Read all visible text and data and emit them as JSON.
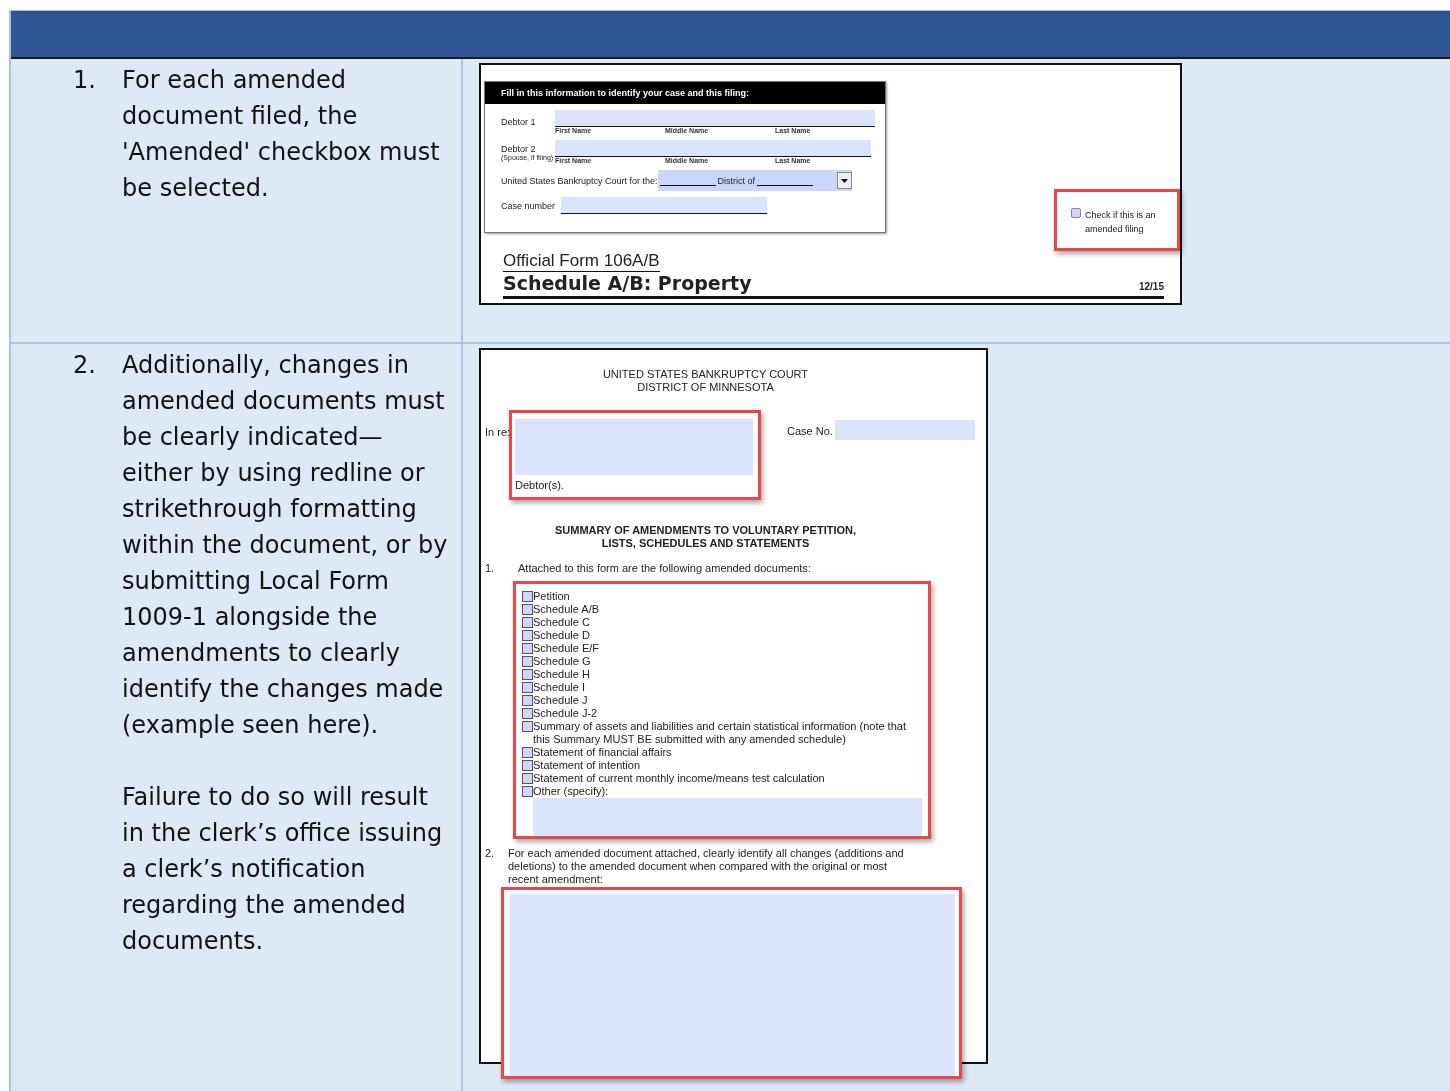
{
  "rows": [
    {
      "number": "1.",
      "paragraphs": [
        "For each amended document filed, the 'Amended' checkbox must be selected."
      ],
      "figure": {
        "kind": "form_header",
        "box_title": "Fill in this information to identify your case and this filing:",
        "debtors": [
          {
            "label": "Debtor 1",
            "columns": [
              "First Name",
              "Middle Name",
              "Last Name"
            ]
          },
          {
            "label": "Debtor 2",
            "sublabel": "(Spouse, if filing)",
            "columns": [
              "First Name",
              "Middle Name",
              "Last Name"
            ]
          }
        ],
        "court_label": "United States Bankruptcy Court for the:",
        "district_label": "District of",
        "case_label": "Case number",
        "amended": {
          "label": "Check if this is an amended filing",
          "checked": false
        },
        "form_name": "Official Form 106A/B",
        "form_title": "Schedule A/B: Property",
        "revision": "12/15"
      }
    },
    {
      "number": "2.",
      "paragraphs": [
        "Additionally, changes in amended documents must be clearly indicated—either by using redline or strikethrough formatting within the document, or by submitting Local Form 1009-1 alongside the amendments to clearly identify the changes made (example seen here).",
        "Failure to do so will result in the clerk’s office issuing a clerk’s notification regarding the amended documents."
      ],
      "figure": {
        "kind": "summary_form",
        "court": [
          "UNITED STATES BANKRUPTCY COURT",
          "DISTRICT OF MINNESOTA"
        ],
        "in_re": "In re:",
        "debtors_label": "Debtor(s).",
        "case_no": "Case No.",
        "heading": [
          "SUMMARY OF AMENDMENTS TO VOLUNTARY PETITION,",
          "LISTS, SCHEDULES AND STATEMENTS"
        ],
        "item_1": {
          "number": "1.",
          "text": "Attached to this form are the following amended documents:"
        },
        "documents": [
          {
            "label": "Petition",
            "checked": false
          },
          {
            "label": "Schedule A/B",
            "checked": false
          },
          {
            "label": "Schedule C",
            "checked": false
          },
          {
            "label": "Schedule D",
            "checked": false
          },
          {
            "label": "Schedule E/F",
            "checked": false
          },
          {
            "label": "Schedule G",
            "checked": false
          },
          {
            "label": "Schedule H",
            "checked": false
          },
          {
            "label": "Schedule I",
            "checked": false
          },
          {
            "label": "Schedule J",
            "checked": false
          },
          {
            "label": "Schedule J-2",
            "checked": false
          },
          {
            "label": "Summary of assets and liabilities and certain statistical information (note that this Summary MUST BE submitted with any amended schedule)",
            "checked": false
          },
          {
            "label": "Statement of financial affairs",
            "checked": false
          },
          {
            "label": "Statement of intention",
            "checked": false
          },
          {
            "label": "Statement of current monthly income/means test calculation",
            "checked": false
          },
          {
            "label": "Other (specify):",
            "checked": false
          }
        ],
        "item_2": {
          "number": "2.",
          "text": "For each amended document attached, clearly identify all changes (additions and deletions) to the amended document when compared with the original or most recent amendment:"
        }
      }
    }
  ]
}
